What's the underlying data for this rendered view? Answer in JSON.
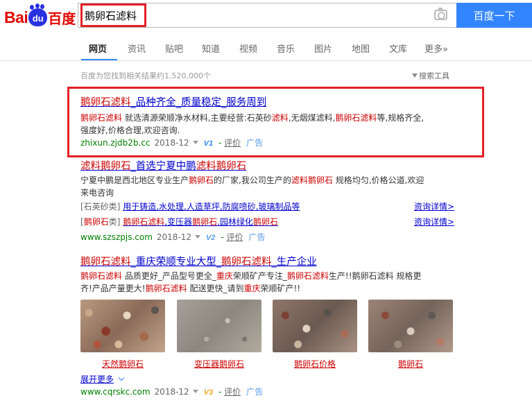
{
  "header": {
    "logo_bai": "Bai",
    "logo_du": "du",
    "logo_cn": "百度",
    "search_value": "鹅卵石滤料",
    "search_button": "百度一下"
  },
  "tabs": [
    {
      "label": "网页",
      "active": true
    },
    {
      "label": "资讯"
    },
    {
      "label": "贴吧"
    },
    {
      "label": "知道"
    },
    {
      "label": "视频"
    },
    {
      "label": "音乐"
    },
    {
      "label": "图片"
    },
    {
      "label": "地图"
    },
    {
      "label": "文库"
    },
    {
      "label": "更多»"
    }
  ],
  "meta": {
    "result_count": "百度为您找到相关结果约1,520,000个",
    "tools": "搜索工具"
  },
  "results": [
    {
      "title_parts": [
        "鹅卵石滤料",
        "_品种齐全_质量稳定_服务周到"
      ],
      "abstract_line1": [
        "鹅卵石滤料",
        " 就选清源荣顺净水材料,主要经营:石英砂",
        "滤料",
        ",无烟煤滤料,",
        "鹅卵石滤料",
        "等,规格齐全,"
      ],
      "abstract_line2": "强度好,价格合理,欢迎咨询.",
      "url": "zhixun.zjdb2b.cc",
      "date": "2018-12",
      "badge": "V1",
      "eval": "评价",
      "ad": "广告"
    },
    {
      "title_parts": [
        "滤料鹅卵石",
        "_首选宁夏中鹏",
        "滤料鹅卵石"
      ],
      "abstract_line1": [
        "宁夏中鹏是西北地区专业生产",
        "鹅卵石",
        "的厂家,我公司生产的",
        "滤料鹅卵石",
        " 规格均匀,价格公道,欢迎"
      ],
      "abstract_line2": "来电咨询",
      "sub1_bracket": "[石英砂类]",
      "sub1_link": "用于铸造,水处理,人造草坪,防腐喷砂,玻璃制品等",
      "sub2_bracket_parts": [
        "[",
        "鹅卵石",
        "类]"
      ],
      "sub2_link_parts": [
        "鹅卵石滤料",
        ",变压器",
        "鹅卵石",
        ",园林绿化",
        "鹅卵石"
      ],
      "detail": "资询详情>",
      "url": "www.szszpjs.com",
      "date": "2018-12",
      "badge": "V2",
      "eval": "评价",
      "ad": "广告"
    },
    {
      "title_parts": [
        "鹅卵石滤料",
        "_重庆荣顺专业大型_",
        "鹅卵石滤料",
        "_生产企业"
      ],
      "abstract_line1": [
        "鹅卵石滤料",
        " 品质更好_产品型号更全_",
        "重庆",
        "荣顺矿产专注_",
        "鹅卵石滤料",
        "生产!!鹅卵石滤料 规格更"
      ],
      "abstract_line2_parts": [
        "齐!产品产量更大!",
        "鹅卵石滤料",
        " 配送更快_请到",
        "重庆",
        "荣顺矿产!!"
      ],
      "thumbs": [
        "天然鹅卵石",
        "变压器鹅卵石",
        "鹅卵石价格",
        "鹅卵石"
      ],
      "expand": "展开更多",
      "url": "www.cqrskc.com",
      "date": "2018-12",
      "badge": "V3",
      "eval": "评价",
      "ad": "广告"
    }
  ]
}
